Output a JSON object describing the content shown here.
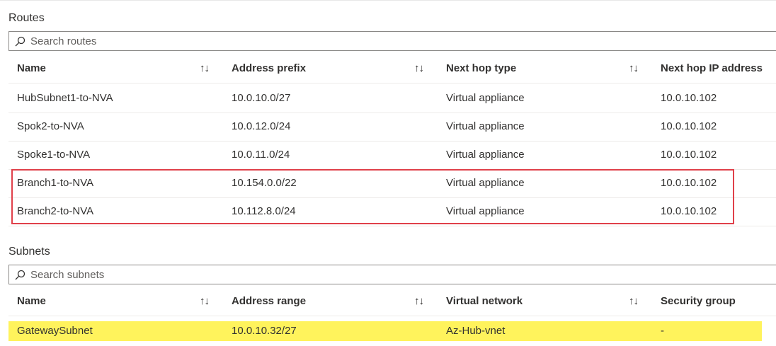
{
  "routes": {
    "title": "Routes",
    "search_placeholder": "Search routes",
    "columns": [
      "Name",
      "Address prefix",
      "Next hop type",
      "Next hop IP address"
    ],
    "rows": [
      {
        "name": "HubSubnet1-to-NVA",
        "prefix": "10.0.10.0/27",
        "hop_type": "Virtual appliance",
        "hop_ip": "10.0.10.102"
      },
      {
        "name": "Spok2-to-NVA",
        "prefix": "10.0.12.0/24",
        "hop_type": "Virtual appliance",
        "hop_ip": "10.0.10.102"
      },
      {
        "name": "Spoke1-to-NVA",
        "prefix": "10.0.11.0/24",
        "hop_type": "Virtual appliance",
        "hop_ip": "10.0.10.102"
      },
      {
        "name": "Branch1-to-NVA",
        "prefix": "10.154.0.0/22",
        "hop_type": "Virtual appliance",
        "hop_ip": "10.0.10.102"
      },
      {
        "name": "Branch2-to-NVA",
        "prefix": "10.112.8.0/24",
        "hop_type": "Virtual appliance",
        "hop_ip": "10.0.10.102"
      }
    ]
  },
  "subnets": {
    "title": "Subnets",
    "search_placeholder": "Search subnets",
    "columns": [
      "Name",
      "Address range",
      "Virtual network",
      "Security group"
    ],
    "rows": [
      {
        "name": "GatewaySubnet",
        "range": "10.0.10.32/27",
        "vnet": "Az-Hub-vnet",
        "nsg": "-"
      }
    ]
  },
  "sort_icon": "↑↓",
  "colors": {
    "highlight_border": "#e0404a",
    "highlight_row": "#fff35c"
  }
}
